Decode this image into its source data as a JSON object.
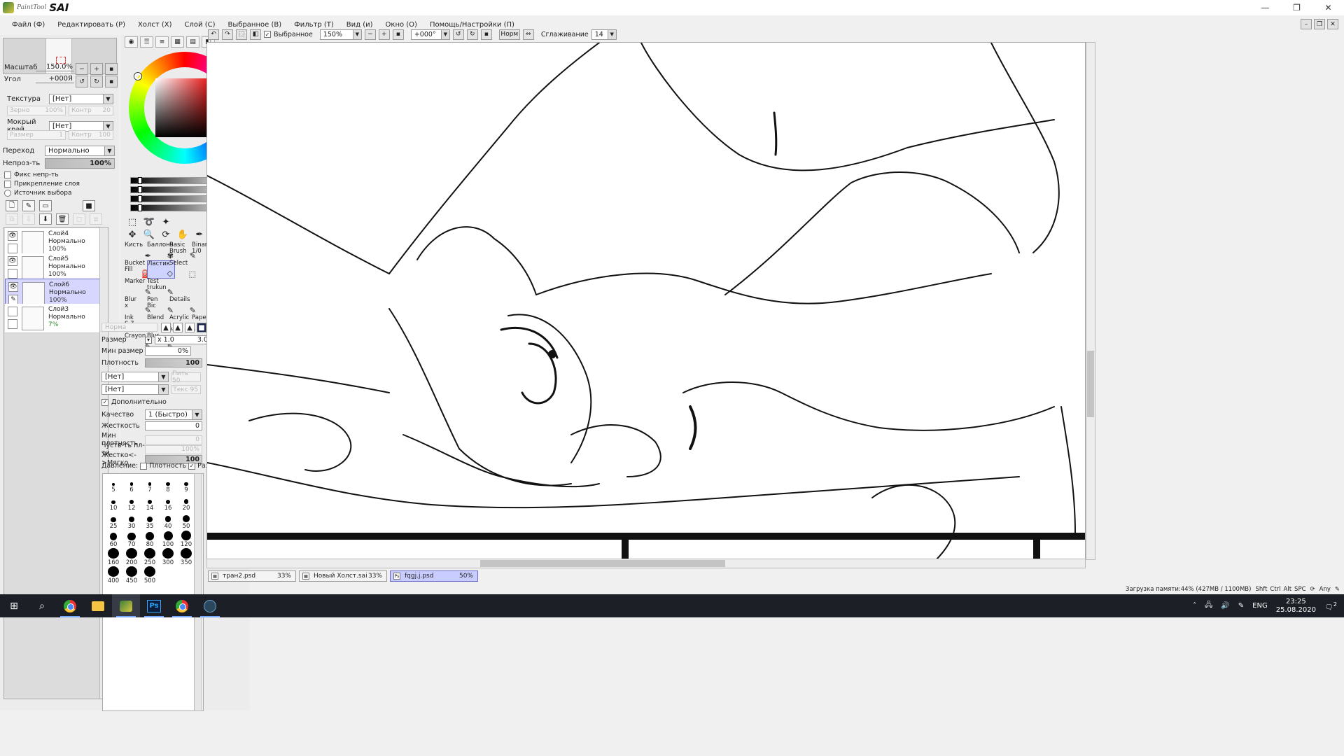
{
  "app": {
    "logo_small": "PaintTool",
    "logo_big": "SAI",
    "window_buttons": [
      "—",
      "❐",
      "✕"
    ]
  },
  "menu": [
    "Файл (Ф)",
    "Редактировать (Р)",
    "Холст (Х)",
    "Слой (С)",
    "Выбранное (В)",
    "Фильтр (Т)",
    "Вид (и)",
    "Окно (О)",
    "Помощь/Настройки (П)"
  ],
  "navigator": {
    "zoom_label": "Масштаб",
    "zoom_value": "150.0%",
    "angle_label": "Угол",
    "angle_value": "+000Я"
  },
  "left_props": {
    "texture_label": "Текстура",
    "texture_value": "[Нет]",
    "grain_label": "Зерно",
    "grain_value": "100%",
    "contrast_label": "Контр",
    "contrast_value": "20",
    "wet_label": "Мокрый край",
    "wet_value": "[Нет]",
    "size_label": "Размер",
    "size_value": "1",
    "contrast2_label": "Контр",
    "contrast2_value": "100",
    "blend_label": "Переход",
    "blend_value": "Нормально",
    "opacity_label": "Непроз-ть",
    "opacity_value": "100%",
    "fix_opacity": "Фикс непр-ть",
    "clip_layer": "Прикрепление слоя",
    "selection_source": "Источник выбора"
  },
  "layers": [
    {
      "name": "Слой4",
      "mode": "Нормально",
      "opacity": "100%",
      "visible": true,
      "selected": false
    },
    {
      "name": "Слой5",
      "mode": "Нормально",
      "opacity": "100%",
      "visible": true,
      "selected": false
    },
    {
      "name": "Слой6",
      "mode": "Нормально",
      "opacity": "100%",
      "visible": true,
      "selected": true
    },
    {
      "name": "Слой3",
      "mode": "Нормально",
      "opacity": "7%",
      "visible": false,
      "selected": false
    }
  ],
  "brushes": [
    {
      "label": "Кисть",
      "label2": ""
    },
    {
      "label": "Баллонч",
      "label2": ""
    },
    {
      "label": "Basic",
      "label2": "Brush"
    },
    {
      "label": "Binary",
      "label2": "1/0"
    },
    {
      "label": "Bucket",
      "label2": "Fill"
    },
    {
      "label": "Ластик",
      "label2": ""
    },
    {
      "label": "Select",
      "label2": ""
    },
    {
      "label": "",
      "label2": ""
    },
    {
      "label": "Marker",
      "label2": ""
    },
    {
      "label": "Test",
      "label2": "trukun"
    },
    {
      "label": "",
      "label2": ""
    },
    {
      "label": "",
      "label2": ""
    },
    {
      "label": "Blur",
      "label2": "x"
    },
    {
      "label": "Pen",
      "label2": "Bic"
    },
    {
      "label": "Details",
      "label2": ""
    },
    {
      "label": "",
      "label2": ""
    },
    {
      "label": "Ink",
      "label2": "S 7"
    },
    {
      "label": "Blend",
      "label2": ""
    },
    {
      "label": "Acrylic",
      "label2": ""
    },
    {
      "label": "Paper",
      "label2": ""
    },
    {
      "label": "Crayon",
      "label2": ""
    },
    {
      "label": "Blur",
      "label2": ""
    }
  ],
  "tool_props": {
    "mode_value": "Норма",
    "size_label": "Размер",
    "size_mult": "x 1.0",
    "size_value": "3.0",
    "min_size_label": "Мин размер",
    "min_size_value": "0%",
    "density_label": "Плотность",
    "density_value": "100",
    "shape1_value": "[Нет]",
    "shape1_dim": "Пить 50",
    "shape2_value": "[Нет]",
    "shape2_dim": "Текс 95",
    "advanced_label": "Дополнительно",
    "quality_label": "Качество",
    "quality_value": "1 (Быстро)",
    "hardness_label": "Жесткость",
    "hardness_value": "0",
    "min_density_label": "Мин плотность",
    "min_density_value": "0",
    "sensitivity_label": "Чуств-ть пл-ти",
    "sensitivity_value": "100%",
    "hard_soft_label": "Жестко<->Мягко",
    "hard_soft_value": "100",
    "pressure_label": "Давление:",
    "pressure_density": "Плотность",
    "pressure_size": "Размер"
  },
  "brush_sizes": [
    "5",
    "6",
    "7",
    "8",
    "9",
    "10",
    "12",
    "14",
    "16",
    "20",
    "25",
    "30",
    "35",
    "40",
    "50",
    "60",
    "70",
    "80",
    "100",
    "120",
    "160",
    "200",
    "250",
    "300",
    "350",
    "400",
    "450",
    "500"
  ],
  "canvas_toolbar": {
    "selected_label": "Выбранное",
    "zoom_value": "150%",
    "angle_value": "+000°",
    "norm_label": "Норм",
    "smoothing_label": "Сглаживание",
    "smoothing_value": "14"
  },
  "doc_tabs": [
    {
      "name": "тран2.psd",
      "percent": "33%",
      "active": false
    },
    {
      "name": "Новый Холст.sai",
      "percent": "33%",
      "active": false
    },
    {
      "name": "fqgj.j.psd",
      "percent": "50%",
      "active": true
    }
  ],
  "status": {
    "memory": "Загрузка памяти:44% (427MB / 1100MB)",
    "keys": [
      "Shft",
      "Ctrl",
      "Alt",
      "SPC"
    ],
    "any_label": "Any"
  },
  "taskbar": {
    "language": "ENG",
    "time": "23:25",
    "date": "25.08.2020",
    "notification_count": "2"
  },
  "colors": {
    "accent_selection": "#6a6ac8",
    "selected_layer_bg": "#d6d6ff",
    "taskbar_bg": "#1c1f26"
  }
}
